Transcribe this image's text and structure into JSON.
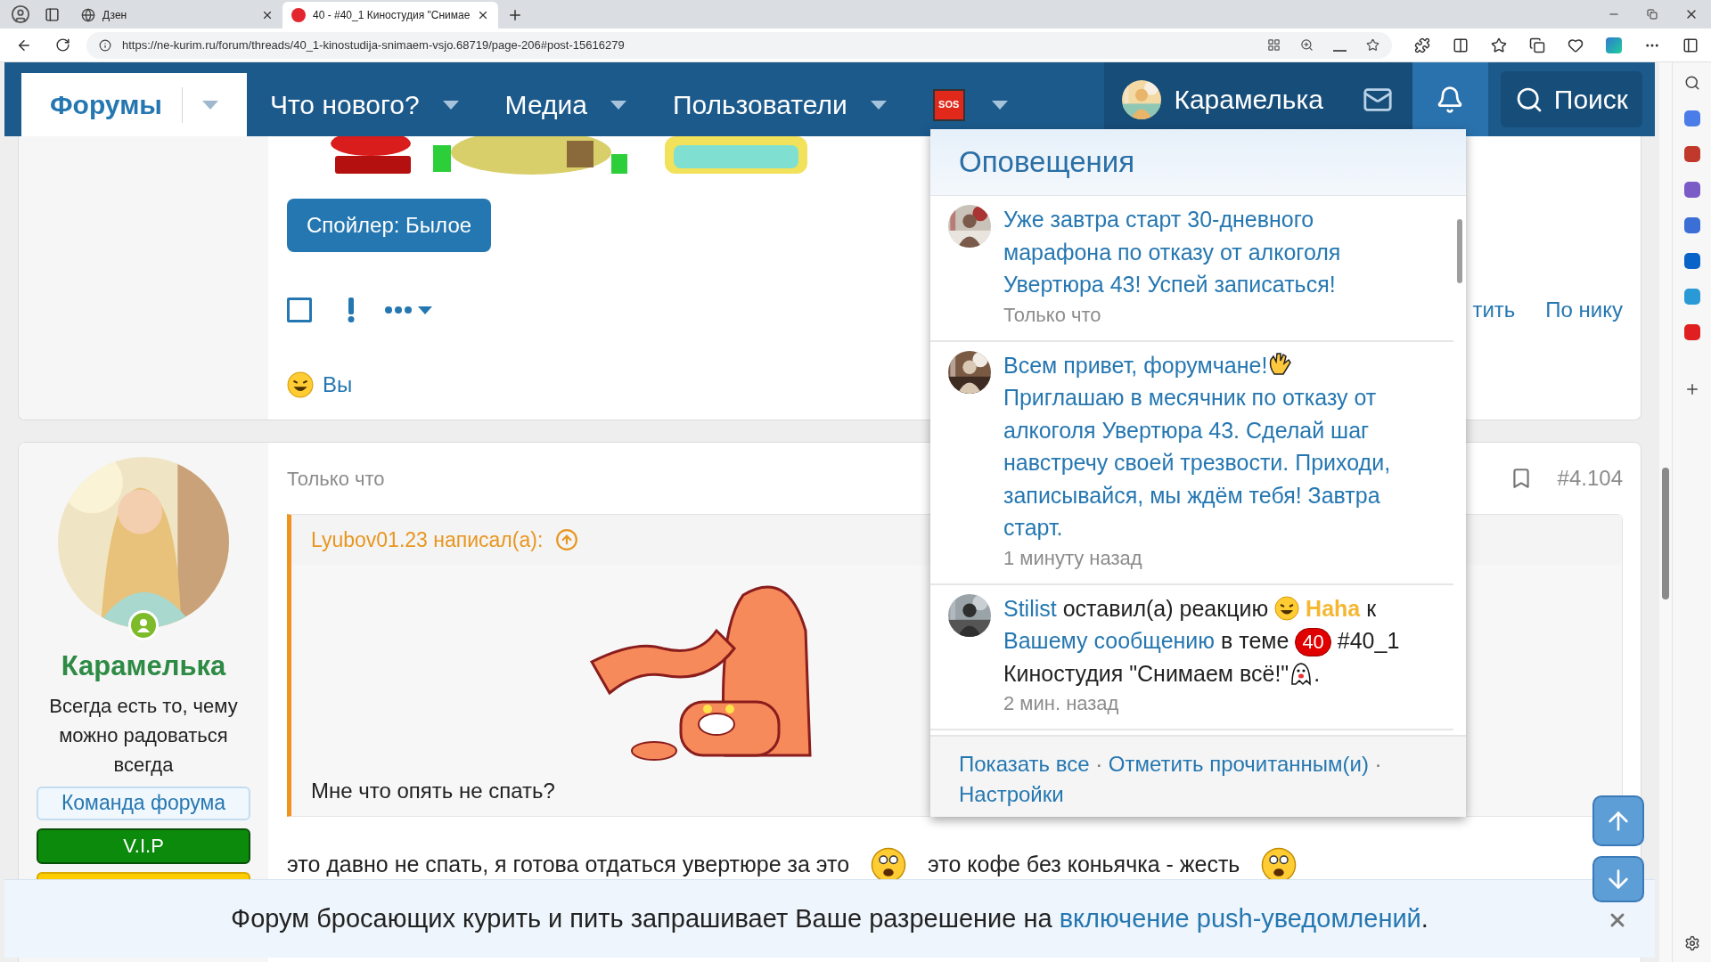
{
  "browser": {
    "tabs": [
      {
        "title": "Дзен",
        "selected": false
      },
      {
        "title": "40 - #40_1 Киностудия \"Снимае",
        "selected": true
      }
    ],
    "url": "https://ne-kurim.ru/forum/threads/40_1-kinostudija-snimaem-vsjo.68719/page-206#post-15616279"
  },
  "nav": {
    "items": [
      {
        "kind": "tab",
        "label": "Форумы",
        "selected": true
      },
      {
        "kind": "tab",
        "label": "Что нового?",
        "selected": false
      },
      {
        "kind": "tab",
        "label": "Медиа",
        "selected": false
      },
      {
        "kind": "tab",
        "label": "Пользователи",
        "selected": false
      },
      {
        "kind": "sos",
        "label": "SOS",
        "selected": false
      }
    ],
    "user": "Карамелька",
    "alerts": {
      "selected": true
    },
    "search": "Поиск"
  },
  "post1": {
    "spoiler": "Спойлер: Былое",
    "checked": false,
    "reaction": "Вы",
    "links": [
      "тить",
      "По нику"
    ]
  },
  "post2": {
    "author": {
      "name": "Карамелька",
      "online": true,
      "status": "Всегда есть то, чему можно радоваться всегда",
      "badges": [
        {
          "kind": "team",
          "label": "Команда форума"
        },
        {
          "kind": "vip",
          "label": "V.I.P"
        },
        {
          "kind": "bar"
        }
      ]
    },
    "time": "Только что",
    "number": "#4.104",
    "quote": {
      "author": "Lyubov01.23 написал(а):",
      "text": "Мне что опять не спать?"
    },
    "body": [
      {
        "kind": "text",
        "text": "это давно не спать, я готова отдаться увертюре за это"
      },
      {
        "kind": "emoji"
      },
      {
        "kind": "text",
        "text": "это кофе без коньячка - жесть"
      },
      {
        "kind": "emoji"
      }
    ]
  },
  "alerts": {
    "title": "Оповещения",
    "items": [
      {
        "kind": "link",
        "parts": [
          {
            "kind": "text",
            "text": "Уже завтра старт 30-дневного марафона по отказу от алкоголя Увертюра 43! Успей записаться!"
          }
        ],
        "time": "Только что"
      },
      {
        "kind": "link",
        "parts": [
          {
            "kind": "text",
            "text": "Всем привет, форумчане!"
          },
          {
            "kind": "wave"
          },
          {
            "kind": "text",
            "text": " Приглашаю в месячник по отказу от алкоголя Увертюра 43. Сделай шаг навстречу своей трезвости. Приходи, записывайся, мы ждём тебя! Завтра старт."
          }
        ],
        "time": "1 минуту назад"
      },
      {
        "kind": "text",
        "parts": [
          {
            "kind": "link",
            "text": "Stilist"
          },
          {
            "kind": "text",
            "text": " оставил(а) реакцию "
          },
          {
            "kind": "laugh"
          },
          {
            "kind": "reaction",
            "text": " Haha"
          },
          {
            "kind": "text",
            "text": " к "
          },
          {
            "kind": "link",
            "text": "Вашему сообщению"
          },
          {
            "kind": "text",
            "text": " в теме "
          },
          {
            "kind": "badge",
            "text": "40"
          },
          {
            "kind": "text",
            "text": " #40_1 Киностудия \"Снимаем всё!\""
          },
          {
            "kind": "ghost"
          },
          {
            "kind": "text",
            "text": "."
          }
        ],
        "time": "2 мин. назад"
      }
    ],
    "footer": {
      "links": [
        "Показать все",
        "Отметить прочитанным(и)",
        "Настройки"
      ],
      "separator": "·"
    }
  },
  "banner": {
    "text": "Форум бросающих курить и пить запрашивает Ваше разрешение на ",
    "link": "включение push-уведомлений",
    "end": "."
  }
}
